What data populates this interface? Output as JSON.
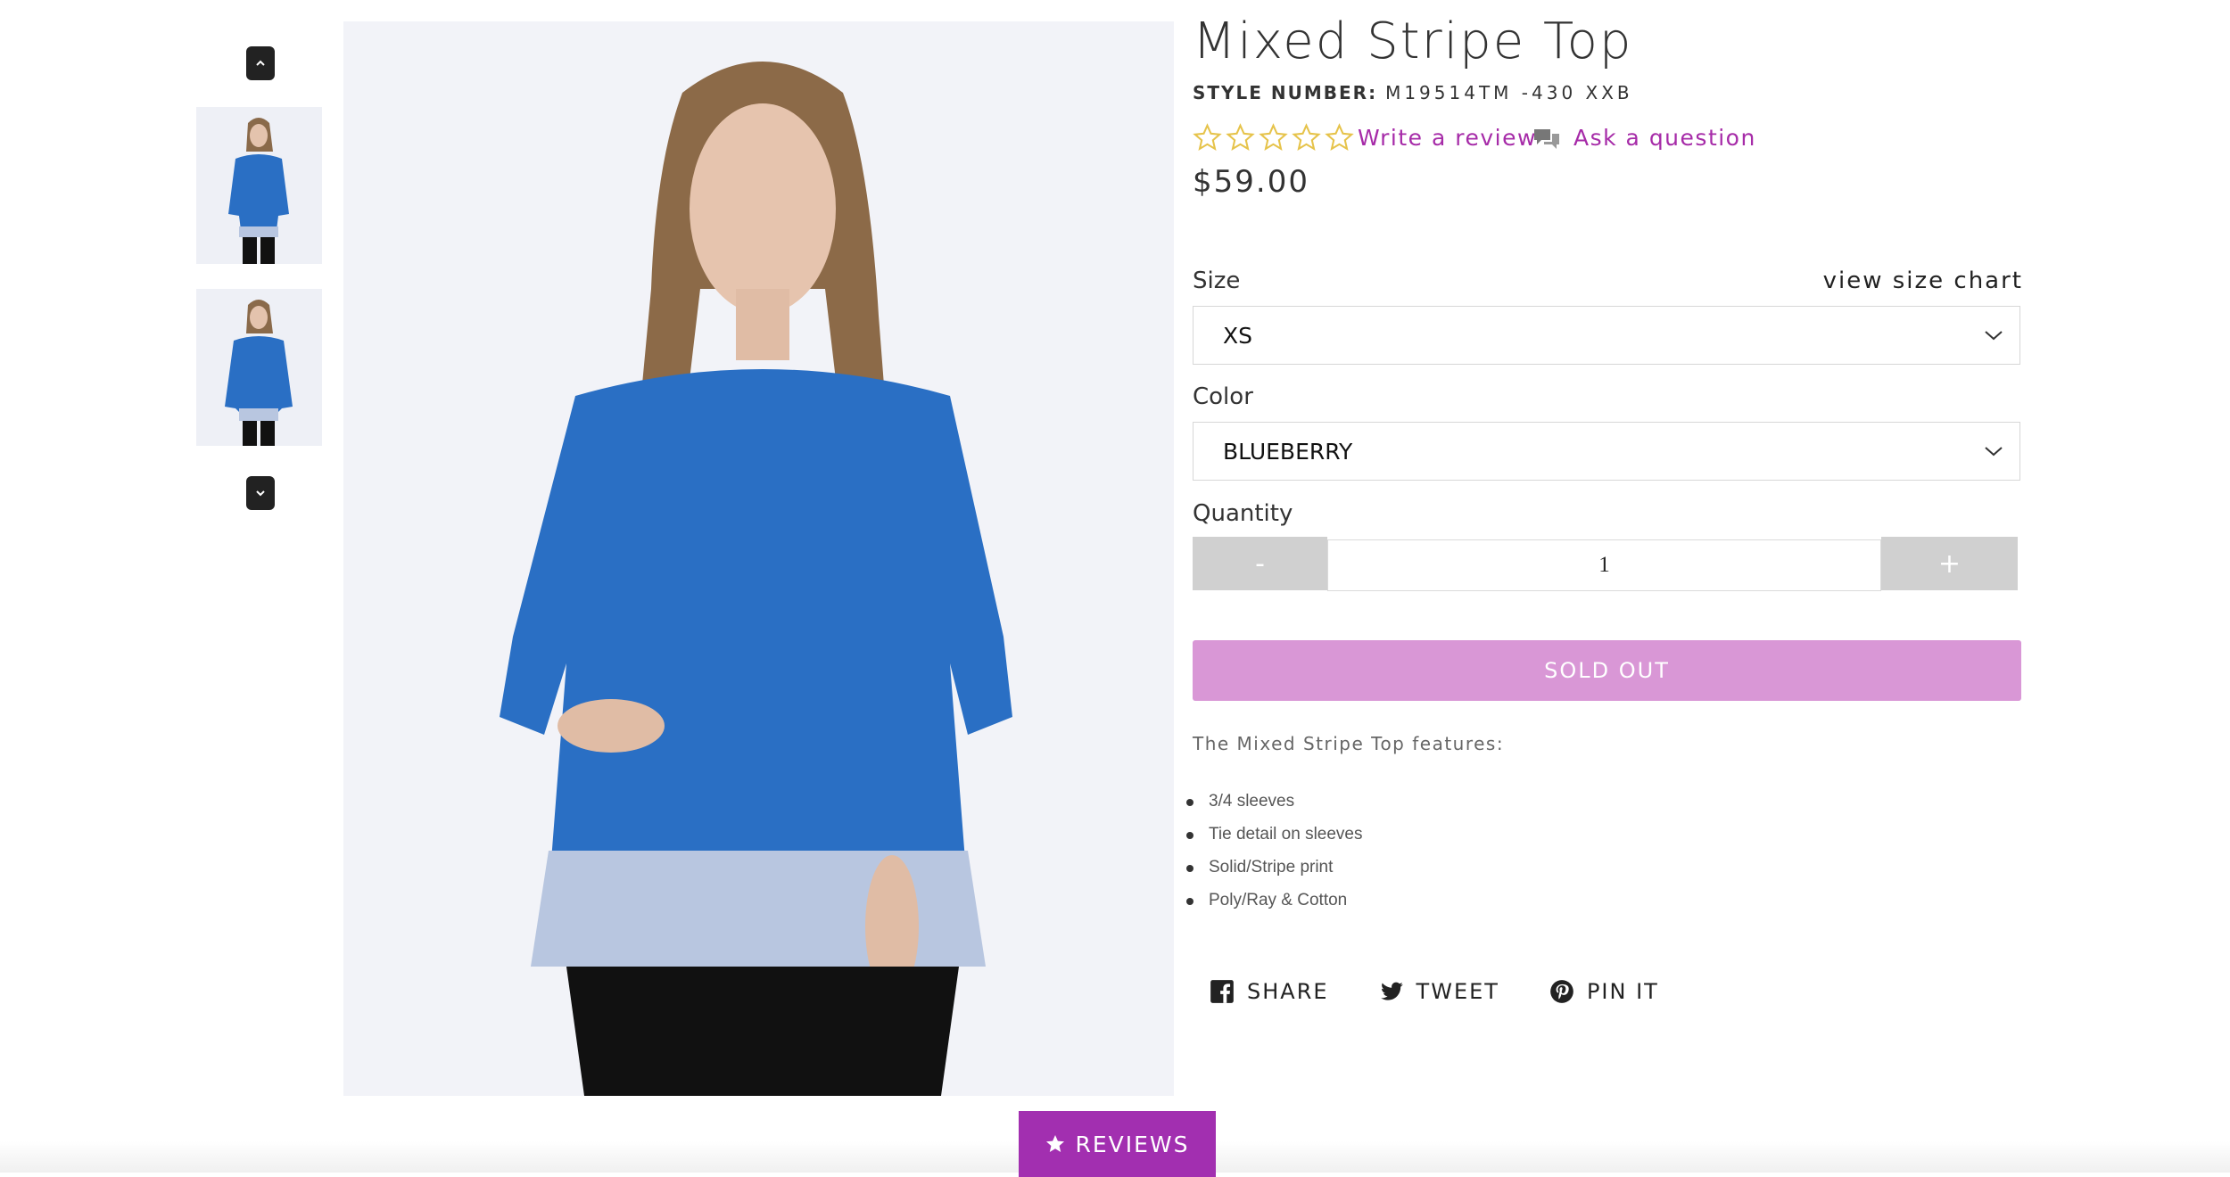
{
  "product": {
    "title": "Mixed Stripe Top",
    "style_label": "STYLE NUMBER:",
    "style_number": "M19514TM -430 XXB",
    "price": "$59.00",
    "rating_stars": 5,
    "write_review": "Write a review",
    "ask_question": "Ask a question"
  },
  "options": {
    "size_label": "Size",
    "size_chart": "view size chart",
    "size_value": "XS",
    "color_label": "Color",
    "color_value": "BLUEBERRY",
    "quantity_label": "Quantity",
    "qty_minus": "-",
    "qty_value": "1",
    "qty_plus": "+"
  },
  "cta": {
    "sold_out": "SOLD OUT"
  },
  "description": {
    "intro": "The Mixed Stripe Top features:",
    "items": [
      "3/4 sleeves",
      "Tie detail on sleeves",
      "Solid/Stripe print",
      "Poly/Ray & Cotton"
    ]
  },
  "share": {
    "facebook": "SHARE",
    "twitter": "TWEET",
    "pinterest": "PIN IT"
  },
  "reviews_tab": {
    "label": "REVIEWS"
  },
  "colors": {
    "accent": "#a62ba8",
    "sold_out_bg": "#d997d6",
    "star": "#e6c34a",
    "top_blue": "#2a6fc4"
  }
}
